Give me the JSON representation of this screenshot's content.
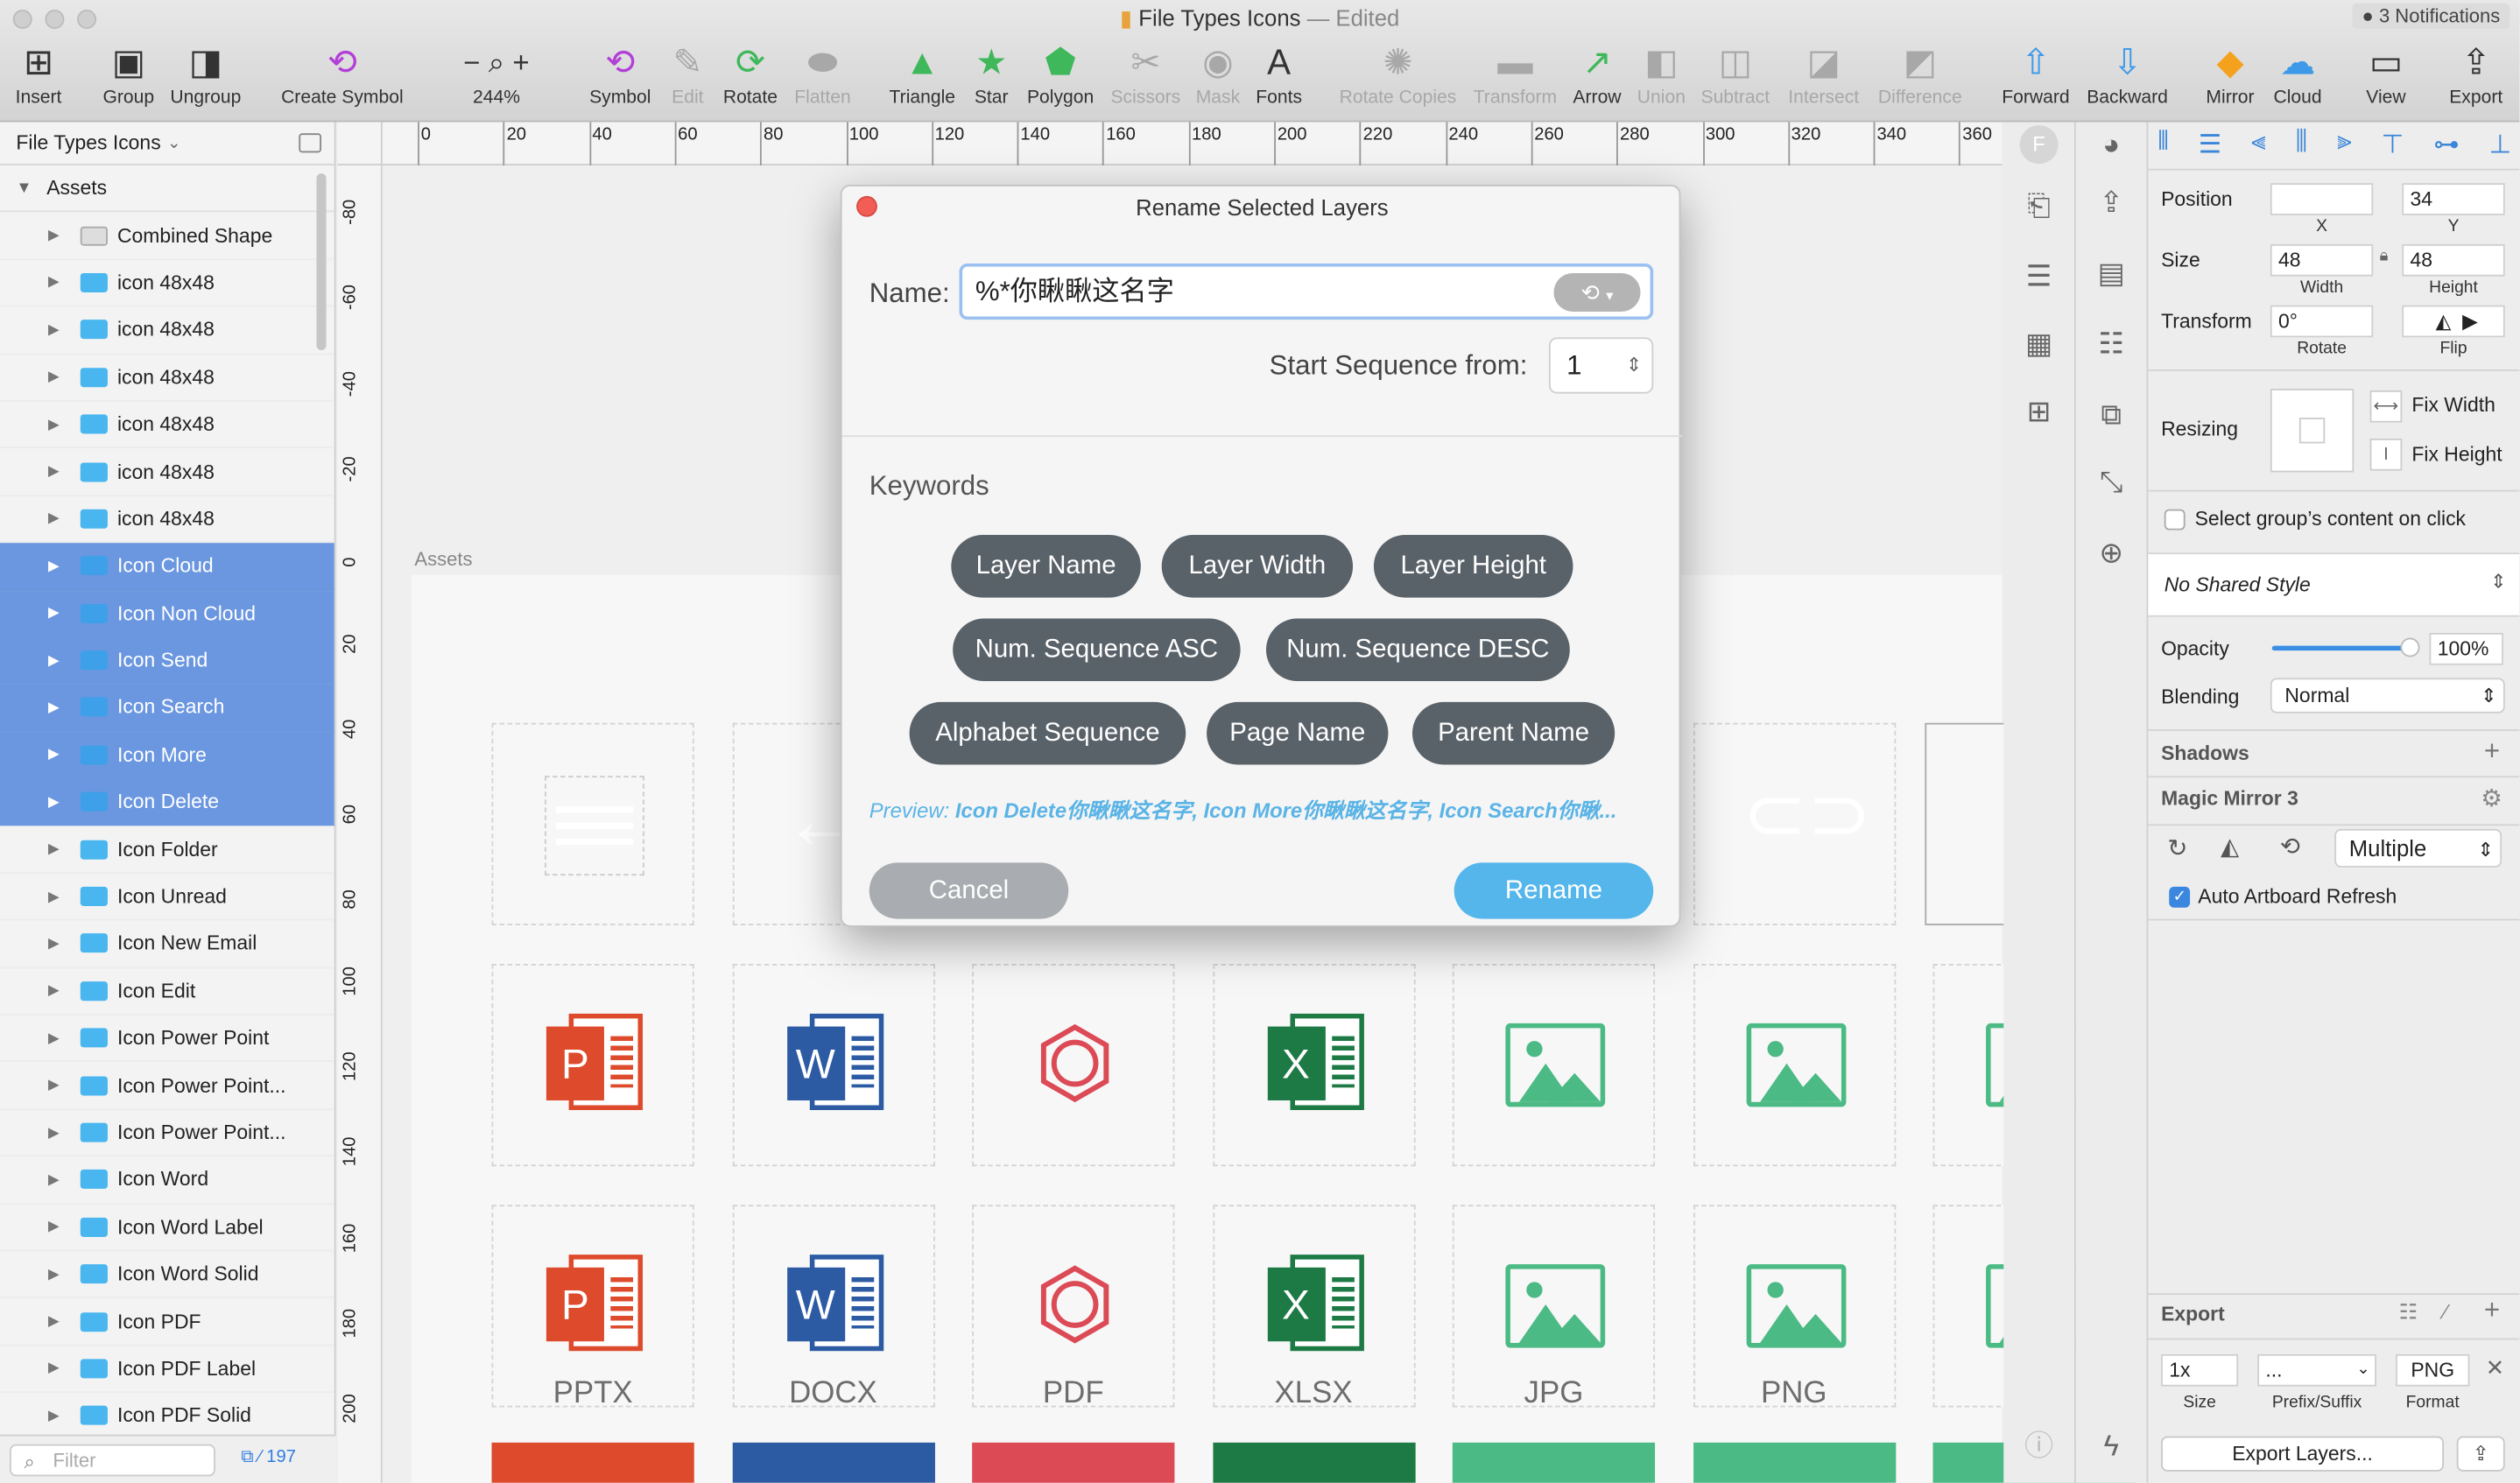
{
  "window": {
    "title": "File Types Icons",
    "edited": "— Edited",
    "notifications": "3 Notifications"
  },
  "toolbar": [
    {
      "label": "Insert",
      "icon": "plus-icon",
      "enabled": true
    },
    {
      "label": "Group",
      "icon": "group-icon",
      "enabled": true
    },
    {
      "label": "Ungroup",
      "icon": "ungroup-icon",
      "enabled": true
    },
    {
      "label": "Create Symbol",
      "icon": "create-symbol-icon",
      "enabled": true
    },
    {
      "label": "244%",
      "icon": "zoom-icon",
      "enabled": true
    },
    {
      "label": "Symbol",
      "icon": "symbol-icon",
      "enabled": true
    },
    {
      "label": "Edit",
      "icon": "edit-icon",
      "enabled": false
    },
    {
      "label": "Rotate",
      "icon": "rotate-icon",
      "enabled": true
    },
    {
      "label": "Flatten",
      "icon": "flatten-icon",
      "enabled": false
    },
    {
      "label": "Triangle",
      "icon": "triangle-icon",
      "enabled": true
    },
    {
      "label": "Star",
      "icon": "star-icon",
      "enabled": true
    },
    {
      "label": "Polygon",
      "icon": "polygon-icon",
      "enabled": true
    },
    {
      "label": "Scissors",
      "icon": "scissors-icon",
      "enabled": false
    },
    {
      "label": "Mask",
      "icon": "mask-icon",
      "enabled": false
    },
    {
      "label": "Fonts",
      "icon": "fonts-icon",
      "enabled": true
    },
    {
      "label": "Rotate Copies",
      "icon": "rotate-copies-icon",
      "enabled": false
    },
    {
      "label": "Transform",
      "icon": "transform-icon",
      "enabled": false
    },
    {
      "label": "Arrow",
      "icon": "arrow-icon",
      "enabled": true
    },
    {
      "label": "Union",
      "icon": "union-icon",
      "enabled": false
    },
    {
      "label": "Subtract",
      "icon": "subtract-icon",
      "enabled": false
    },
    {
      "label": "Intersect",
      "icon": "intersect-icon",
      "enabled": false
    },
    {
      "label": "Difference",
      "icon": "difference-icon",
      "enabled": false
    },
    {
      "label": "Forward",
      "icon": "forward-icon",
      "enabled": true
    },
    {
      "label": "Backward",
      "icon": "backward-icon",
      "enabled": true
    },
    {
      "label": "Mirror",
      "icon": "mirror-icon",
      "enabled": true
    },
    {
      "label": "Cloud",
      "icon": "cloud-icon",
      "enabled": true
    },
    {
      "label": "View",
      "icon": "view-icon",
      "enabled": true
    },
    {
      "label": "Export",
      "icon": "export-icon",
      "enabled": true
    }
  ],
  "layers_panel": {
    "page": "File Types Icons",
    "group": "Assets",
    "items": [
      {
        "label": "Combined Shape",
        "selected": false
      },
      {
        "label": "icon 48x48",
        "selected": false
      },
      {
        "label": "icon 48x48",
        "selected": false
      },
      {
        "label": "icon 48x48",
        "selected": false
      },
      {
        "label": "icon 48x48",
        "selected": false
      },
      {
        "label": "icon 48x48",
        "selected": false
      },
      {
        "label": "icon 48x48",
        "selected": false
      },
      {
        "label": "Icon Cloud",
        "selected": true
      },
      {
        "label": "Icon Non Cloud",
        "selected": true
      },
      {
        "label": "Icon Send",
        "selected": true
      },
      {
        "label": "Icon Search",
        "selected": true
      },
      {
        "label": "Icon More",
        "selected": true
      },
      {
        "label": "Icon Delete",
        "selected": true
      },
      {
        "label": "Icon Folder",
        "selected": false
      },
      {
        "label": "Icon Unread",
        "selected": false
      },
      {
        "label": "Icon New Email",
        "selected": false
      },
      {
        "label": "Icon Edit",
        "selected": false
      },
      {
        "label": "Icon Power Point",
        "selected": false
      },
      {
        "label": "Icon Power Point...",
        "selected": false
      },
      {
        "label": "Icon Power Point...",
        "selected": false
      },
      {
        "label": "Icon Word",
        "selected": false
      },
      {
        "label": "Icon Word Label",
        "selected": false
      },
      {
        "label": "Icon Word Solid",
        "selected": false
      },
      {
        "label": "Icon PDF",
        "selected": false
      },
      {
        "label": "Icon PDF Label",
        "selected": false
      },
      {
        "label": "Icon PDF Solid",
        "selected": false
      }
    ],
    "filter_placeholder": "Filter",
    "count": "197"
  },
  "hruler": [
    "0",
    "20",
    "40",
    "60",
    "80",
    "100",
    "120",
    "140",
    "160",
    "180",
    "200",
    "220",
    "240",
    "260",
    "280",
    "300",
    "320",
    "340",
    "360"
  ],
  "vruler": [
    "-80",
    "-60",
    "-40",
    "-20",
    "0",
    "20",
    "40",
    "60",
    "80",
    "100",
    "120",
    "140",
    "160",
    "180",
    "200"
  ],
  "canvas": {
    "artboard_label": "Assets",
    "file_labels": [
      "PPTX",
      "DOCX",
      "PDF",
      "XLSX",
      "JPG",
      "PNG"
    ]
  },
  "inspector": {
    "position_label": "Position",
    "x": "",
    "y": "34",
    "x_lbl": "X",
    "y_lbl": "Y",
    "size_label": "Size",
    "width": "48",
    "height": "48",
    "width_lbl": "Width",
    "height_lbl": "Height",
    "transform_label": "Transform",
    "rotate": "0°",
    "rotate_lbl": "Rotate",
    "flip_lbl": "Flip",
    "resizing_label": "Resizing",
    "fix_width": "Fix Width",
    "fix_height": "Fix Height",
    "select_group": "Select group’s content on click",
    "shared_style": "No Shared Style",
    "opacity_label": "Opacity",
    "opacity": "100%",
    "opacity_value": 1.0,
    "blending_label": "Blending",
    "blending": "Normal",
    "shadows": "Shadows",
    "plugin": "Magic Mirror 3",
    "mode": "Multiple",
    "auto_refresh": "Auto Artboard Refresh",
    "export": "Export",
    "exp_size": "1x",
    "exp_prefix": "...",
    "exp_format": "PNG",
    "exp_size_lbl": "Size",
    "exp_prefix_lbl": "Prefix/Suffix",
    "exp_format_lbl": "Format",
    "export_btn": "Export Layers..."
  },
  "dialog": {
    "title": "Rename Selected Layers",
    "name_label": "Name:",
    "name_value": "%*你瞅瞅这名字",
    "seq_label": "Start Sequence from:",
    "seq_value": "1",
    "keywords_label": "Keywords",
    "keywords": [
      "Layer Name",
      "Layer Width",
      "Layer Height",
      "Num. Sequence ASC",
      "Num. Sequence DESC",
      "Alphabet Sequence",
      "Page Name",
      "Parent Name"
    ],
    "preview_label": "Preview:",
    "preview_value": "Icon Delete你瞅瞅这名字, Icon More你瞅瞅这名字, Icon Search你瞅...",
    "cancel": "Cancel",
    "rename": "Rename"
  },
  "colors": {
    "accent": "#55b6ec",
    "selection": "#6b97e0",
    "ppt": "#dd4b2c",
    "word": "#2c5aa3",
    "pdf": "#dc4a56",
    "xls": "#1d7a45",
    "img": "#4cba84"
  }
}
